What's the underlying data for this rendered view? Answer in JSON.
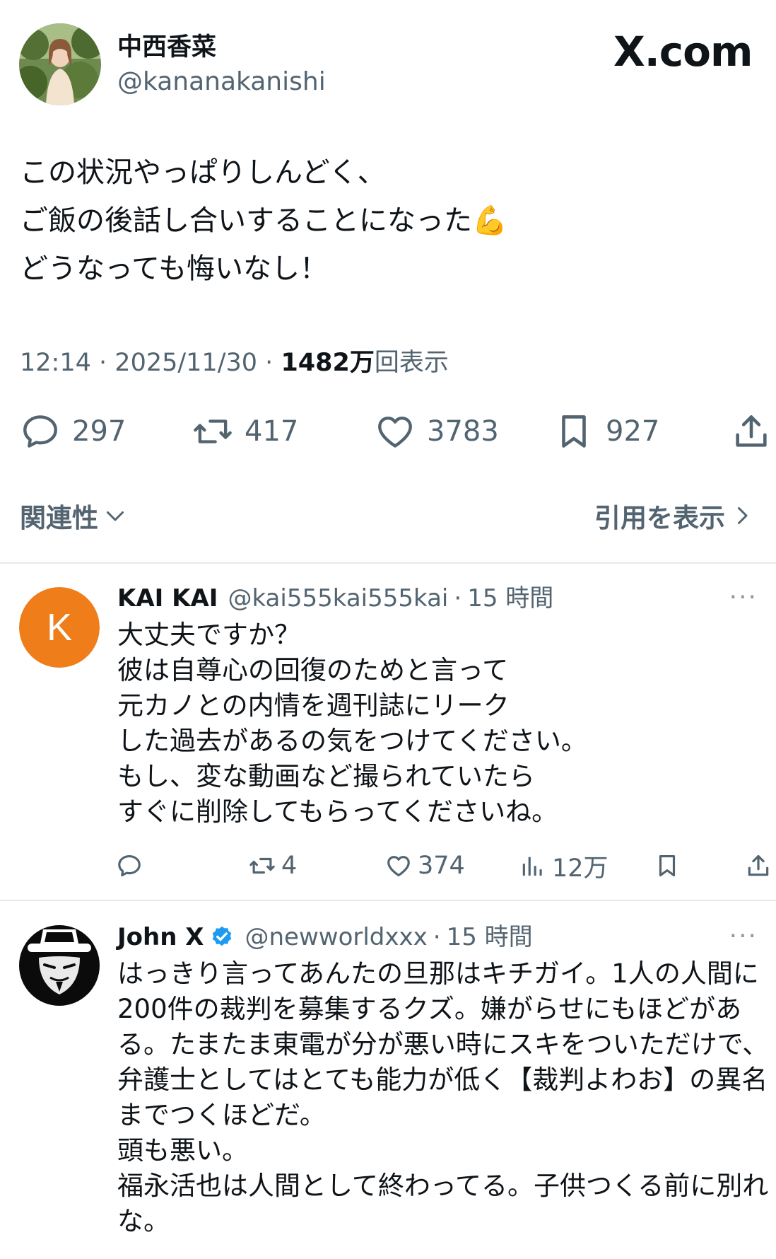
{
  "brand": "X.com",
  "main_tweet": {
    "author": {
      "display_name": "中西香菜",
      "handle": "@kananakanishi"
    },
    "text_lines": [
      "この状況やっぱりしんどく、",
      "ご飯の後話し合いすることになった💪",
      "どうなっても悔いなし！"
    ],
    "time": "12:14",
    "date": "2025/11/30",
    "views_num": "1482万",
    "views_label": "回表示",
    "separator": "·",
    "stats": {
      "replies": "297",
      "reposts": "417",
      "likes": "3783",
      "bookmarks": "927"
    }
  },
  "sort": {
    "label": "関連性"
  },
  "quotes": {
    "label": "引用を表示"
  },
  "replies": [
    {
      "avatar_letter": "K",
      "avatar_color": "#ef7d1a",
      "name": "KAI KAI",
      "handle": "@kai555kai555kai",
      "time": "15 時間",
      "more": "···",
      "lines": [
        "大丈夫ですか？",
        "彼は自尊心の回復のためと言って",
        "元カノとの内情を週刊誌にリーク",
        "した過去があるの気をつけてください。",
        "もし、変な動画など撮られていたら",
        "すぐに削除してもらってくださいね。"
      ],
      "stats": {
        "replies": "",
        "reposts": "4",
        "likes": "374",
        "views": "12万"
      }
    },
    {
      "name": "John X",
      "verified": true,
      "handle": "@newworldxxx",
      "time": "15 時間",
      "more": "···",
      "lines": [
        "はっきり言ってあんたの旦那はキチガイ。1人の人間に",
        "200件の裁判を募集するクズ。嫌がらせにもほどがあ",
        "る。たまたま東電が分が悪い時にスキをついただけで、",
        "弁護士としてはとても能力が低く【裁判よわお】の異名",
        "までつくほどだ。",
        "頭も悪い。",
        "福永活也は人間として終わってる。子供つくる前に別れ",
        "な。"
      ]
    }
  ],
  "colors": {
    "verified": "#1d9bf0",
    "muted": "#536471",
    "text": "#0f1419"
  }
}
